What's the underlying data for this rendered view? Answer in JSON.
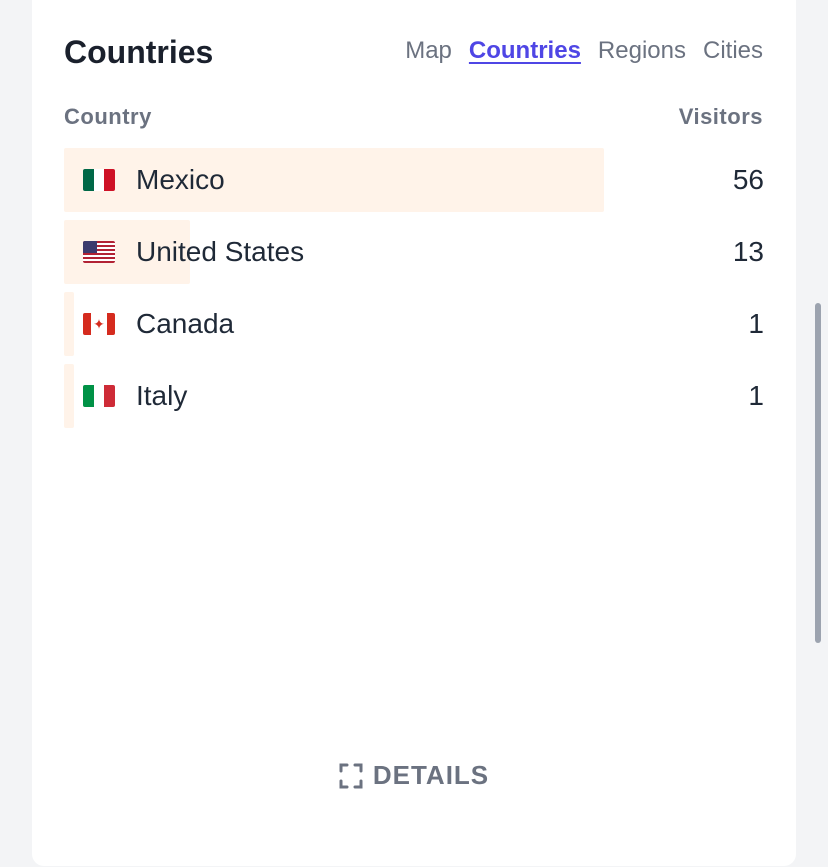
{
  "panel": {
    "title": "Countries",
    "tabs": [
      {
        "label": "Map",
        "active": false
      },
      {
        "label": "Countries",
        "active": true
      },
      {
        "label": "Regions",
        "active": false
      },
      {
        "label": "Cities",
        "active": false
      }
    ],
    "columns": {
      "country": "Country",
      "visitors": "Visitors"
    },
    "rows": [
      {
        "country": "Mexico",
        "visitors": "56",
        "share": 0.8,
        "flag": "flag-mexico-icon"
      },
      {
        "country": "United States",
        "visitors": "13",
        "share": 0.186,
        "flag": "flag-united-states-icon"
      },
      {
        "country": "Canada",
        "visitors": "1",
        "share": 0.014,
        "flag": "flag-canada-icon"
      },
      {
        "country": "Italy",
        "visitors": "1",
        "share": 0.014,
        "flag": "flag-italy-icon"
      }
    ],
    "details_label": "DETAILS"
  },
  "colors": {
    "accent": "#4f46e5",
    "bar": "#fff3e9",
    "muted_text": "#6b7280",
    "text": "#1f2937"
  }
}
